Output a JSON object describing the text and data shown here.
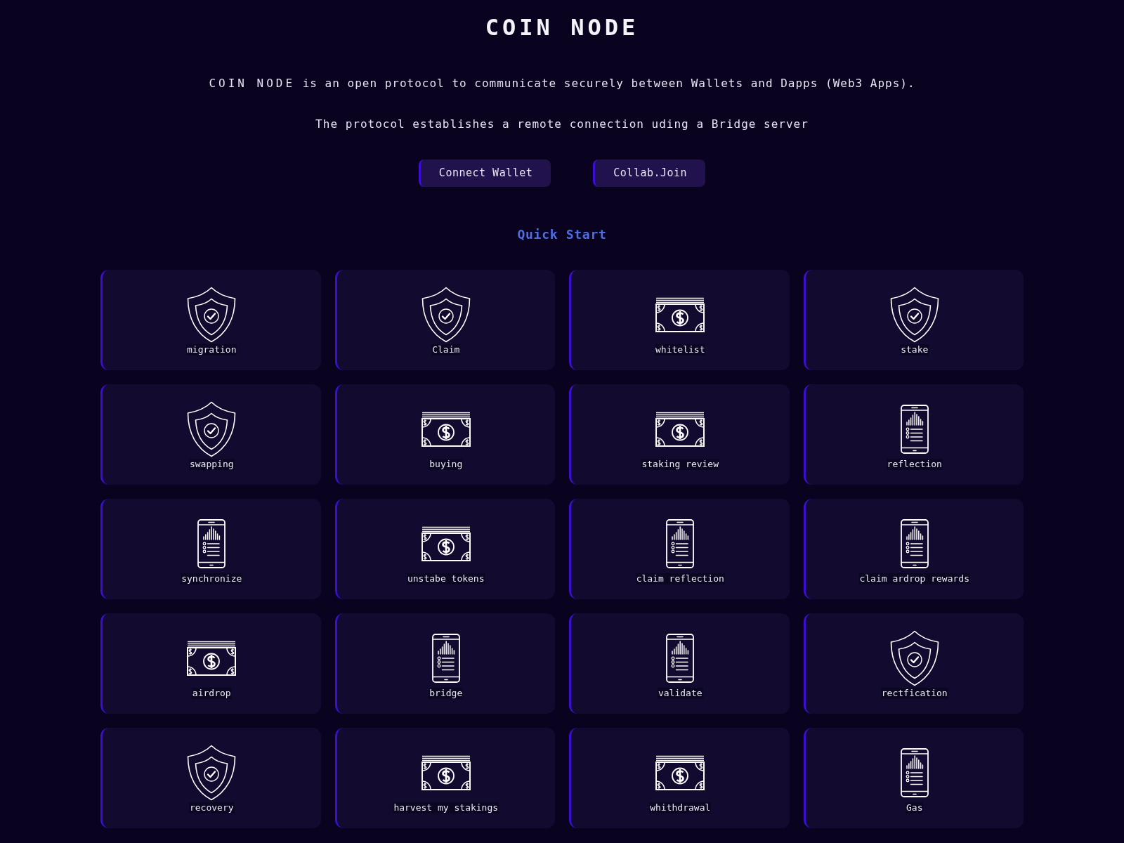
{
  "header": {
    "title": "COIN NODE"
  },
  "intro": {
    "brand": "COIN NODE",
    "text": "is an open protocol to communicate securely between Wallets and Dapps (Web3 Apps)."
  },
  "subtitle": "The protocol establishes a remote connection uding a Bridge server",
  "buttons": [
    {
      "label": "Connect Wallet"
    },
    {
      "label": "Collab.Join"
    }
  ],
  "section_title": "Quick Start",
  "cards": [
    {
      "label": "migration",
      "kind": "shield"
    },
    {
      "label": "Claim",
      "kind": "shield"
    },
    {
      "label": "whitelist",
      "kind": "cash"
    },
    {
      "label": "stake",
      "kind": "shield"
    },
    {
      "label": "swapping",
      "kind": "shield"
    },
    {
      "label": "buying",
      "kind": "cash"
    },
    {
      "label": "staking review",
      "kind": "cash"
    },
    {
      "label": "reflection",
      "kind": "phone"
    },
    {
      "label": "synchronize",
      "kind": "phone"
    },
    {
      "label": "unstabe tokens",
      "kind": "cash"
    },
    {
      "label": "claim reflection",
      "kind": "phone"
    },
    {
      "label": "claim ardrop rewards",
      "kind": "phone"
    },
    {
      "label": "airdrop",
      "kind": "cash"
    },
    {
      "label": "bridge",
      "kind": "phone"
    },
    {
      "label": "validate",
      "kind": "phone"
    },
    {
      "label": "rectfication",
      "kind": "shield"
    },
    {
      "label": "recovery",
      "kind": "shield"
    },
    {
      "label": "harvest my stakings",
      "kind": "cash"
    },
    {
      "label": "whithdrawal",
      "kind": "cash"
    },
    {
      "label": "Gas",
      "kind": "phone"
    }
  ]
}
